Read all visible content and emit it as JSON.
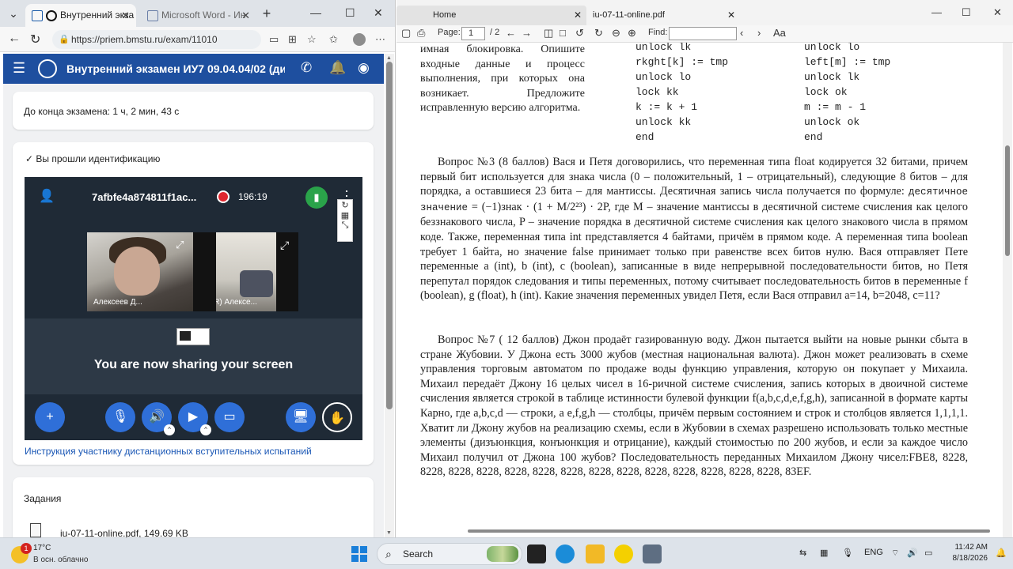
{
  "browser": {
    "tabs": [
      {
        "label": "Внутренний экза",
        "active": true
      },
      {
        "label": "Microsoft Word - Ин",
        "active": false
      }
    ],
    "new_tab_symbol": "+",
    "url": "https://priem.bmstu.ru/exam/11010"
  },
  "app": {
    "title": "Внутренний экзамен ИУ7 09.04.04/02 (дис...",
    "timer_text": "До конца экзамена: 1 ч, 2 мин, 43 с",
    "identification_text": "Вы прошли идентификацию",
    "conference": {
      "room_id": "7afbfe4a874811f1ac...",
      "elapsed": "196:19",
      "participants": [
        {
          "name": "Алексеев Д...",
          "mic": "on"
        },
        {
          "name": "(QR) Алексе...",
          "mic": "off"
        }
      ],
      "share_message": "You are now sharing your screen",
      "controls": [
        "add",
        "microphone",
        "speaker",
        "camera",
        "screen-share",
        "desktop",
        "raise-hand"
      ]
    },
    "instructions_link": "Инструкция участнику дистанционных вступительных испытаний",
    "tasks_title": "Задания",
    "task_file": "iu-07-11-online.pdf, 149.69 KB"
  },
  "pdf": {
    "tabs": [
      {
        "label": "Home"
      },
      {
        "label": "iu-07-11-online.pdf"
      }
    ],
    "toolbar": {
      "page_label": "Page:",
      "page_value": "1",
      "page_total": "/ 2",
      "find_label": "Find:"
    },
    "left_column": "имная блокировка. Опишите входные данные и процесс выполнения, при которых она возникает. Предложите исправленную версию алгоритма.",
    "code_left": [
      "unlock lk",
      "rkght[k] := tmp",
      "unlock lo",
      "lock kk",
      "k := k + 1",
      "unlock kk",
      "end"
    ],
    "code_right": [
      "unlock lo",
      "left[m] := tmp",
      "unlock lk",
      "lock ok",
      "m := m - 1",
      "unlock ok",
      "end"
    ],
    "q3_before_formula": "Вопрос №3 (8 баллов)  Вася и Петя договорились, что переменная типа float кодируется 32 битами, причем первый бит используется для знака числа (0 – положительный, 1 – отрицательный), следующие 8 битов – для порядка, а оставшиеся 23 бита – для мантиссы. Десятичная запись числа получается по формуле: ",
    "q3_formula_code": "десятичное значение",
    "q3_formula_math": " = (−1)знак · (1 + M/2²³) · 2P",
    "q3_after_formula": ", где M – значение мантиссы в десятичной системе счисления как целого беззнакового числа, P – значение порядка в десятичной системе счисления как целого знакового числа в прямом коде. Также, переменная типа int представляется 4 байтами, причём в прямом коде. А переменная типа boolean требует 1 байта, но значение false принимает только при равенстве всех битов нулю. Вася отправляет Пете переменные a (int), b (int), c (boolean), записанные в виде непрерывной последовательности битов, но Петя перепутал порядок следования и типы переменных, потому считывает последовательность битов в переменные f (boolean), g (float), h (int). Какие значения переменных увидел Петя, если Вася отправил a=14, b=2048, c=11?",
    "q7": "Вопрос №7 ( 12 баллов) Джон продаёт газированную воду. Джон пытается выйти на новые рынки сбыта в стране Жубовии. У Джона есть 3000 жубов (местная национальная валюта). Джон может реализовать в схеме управления торговым автоматом по продаже воды функцию управления, которую он покупает у Михаила. Михаил передаёт Джону 16 целых чисел в 16-ричной системе счисления, запись которых в двоичной системе счисления является строкой в таблице истинности булевой функции f(a,b,c,d,e,f,g,h), записанной в формате карты Карно, где a,b,c,d — строки, а e,f,g,h — столбцы, причём первым состоянием и строк и столбцов является 1,1,1,1. Хватит ли Джону жубов на реализацию схемы, если в Жубовии в схемах разрешено использовать только местные элементы (дизъюнкция, конъюнкция и отрицание), каждый стоимостью по 200 жубов, и если за каждое число Михаил получил от Джона 100 жубов? Последовательность переданных Михаилом Джону чисел:FBE8, 8228, 8228, 8228, 8228, 8228, 8228, 8228, 8228, 8228, 8228, 8228, 8228, 8228, 8228, 83EF."
  },
  "taskbar": {
    "weather_badge": "1",
    "temperature": "17°C",
    "condition": "В осн. облачно",
    "search_placeholder": "Search",
    "language": "ENG",
    "time": "11:42 AM",
    "date": "8/18/2026"
  },
  "colors": {
    "app_bar": "#1e4f9f",
    "stage_bg": "#1f2a36",
    "control_blue": "#2f6fd8",
    "record_red": "#e0262e",
    "signal_green": "#2aa34a",
    "link": "#1a57b5"
  }
}
